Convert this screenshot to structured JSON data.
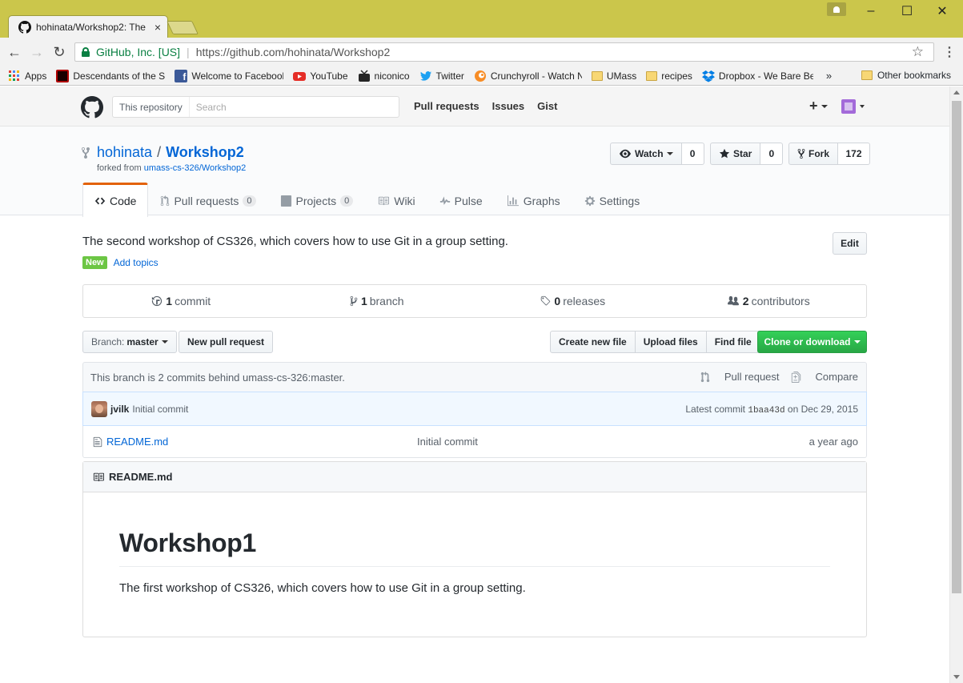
{
  "browser": {
    "tab_title": "hohinata/Workshop2: The",
    "tab_close": "×",
    "secure_label": "GitHub, Inc. [US]",
    "url": "https://github.com/hohinata/Workshop2",
    "window_controls": {
      "minimize": "–",
      "maximize": "☐",
      "close": "✕"
    },
    "nav": {
      "back": "←",
      "forward": "→",
      "reload": "↻"
    },
    "star": "☆",
    "menu": "⋮",
    "bookmarks": [
      {
        "label": "Apps",
        "icon": "apps-grid-icon",
        "color": "#e34133"
      },
      {
        "label": "Descendants of the Su",
        "icon": "descendants-favicon",
        "color": "#b00000"
      },
      {
        "label": "Welcome to Facebook",
        "icon": "facebook-favicon",
        "color": "#3b5998"
      },
      {
        "label": "YouTube",
        "icon": "youtube-favicon",
        "color": "#e52d27"
      },
      {
        "label": "niconico",
        "icon": "niconico-favicon",
        "color": "#252525"
      },
      {
        "label": "Twitter",
        "icon": "twitter-favicon",
        "color": "#1da1f2"
      },
      {
        "label": "Crunchyroll - Watch N",
        "icon": "crunchyroll-favicon",
        "color": "#f78c25"
      },
      {
        "label": "UMass",
        "icon": "folder-icon",
        "color": "#f8d775"
      },
      {
        "label": "recipes",
        "icon": "folder-icon",
        "color": "#f8d775"
      },
      {
        "label": "Dropbox - We Bare Be",
        "icon": "dropbox-favicon",
        "color": "#007ee5"
      }
    ],
    "bookmarks_more": "»",
    "other_bookmarks": "Other bookmarks"
  },
  "github": {
    "search_scope": "This repository",
    "search_placeholder": "Search",
    "nav": [
      "Pull requests",
      "Issues",
      "Gist"
    ],
    "plus": "+",
    "repo": {
      "owner": "hohinata",
      "separator": "/",
      "name": "Workshop2",
      "forked_prefix": "forked from",
      "forked_from": "umass-cs-326/Workshop2"
    },
    "actions": {
      "watch_label": "Watch",
      "watch_count": "0",
      "star_label": "Star",
      "star_count": "0",
      "fork_label": "Fork",
      "fork_count": "172"
    },
    "tabs": [
      {
        "label": "Code",
        "icon": "code-icon"
      },
      {
        "label": "Pull requests",
        "counter": "0",
        "icon": "pull-request-icon"
      },
      {
        "label": "Projects",
        "counter": "0",
        "icon": "project-icon"
      },
      {
        "label": "Wiki",
        "icon": "book-icon"
      },
      {
        "label": "Pulse",
        "icon": "pulse-icon"
      },
      {
        "label": "Graphs",
        "icon": "graph-icon"
      },
      {
        "label": "Settings",
        "icon": "gear-icon"
      }
    ],
    "description": "The second workshop of CS326, which covers how to use Git in a group setting.",
    "edit_label": "Edit",
    "new_badge": "New",
    "add_topics": "Add topics",
    "numbers": [
      {
        "count": "1",
        "label": "commit",
        "icon": "history-icon"
      },
      {
        "count": "1",
        "label": "branch",
        "icon": "branch-icon"
      },
      {
        "count": "0",
        "label": "releases",
        "icon": "tag-icon"
      },
      {
        "count": "2",
        "label": "contributors",
        "icon": "people-icon"
      }
    ],
    "branch_select_label": "Branch:",
    "branch_select_value": "master",
    "new_pull_request": "New pull request",
    "create_new_file": "Create new file",
    "upload_files": "Upload files",
    "find_file": "Find file",
    "clone_or_download": "Clone or download",
    "branch_infobar": "This branch is 2 commits behind umass-cs-326:master.",
    "pull_request_link": "Pull request",
    "compare_link": "Compare",
    "commit": {
      "author": "jvilk",
      "message": "Initial commit",
      "latest_prefix": "Latest commit",
      "sha": "1baa43d",
      "date_text": "on Dec 29, 2015"
    },
    "files": [
      {
        "name": "README.md",
        "message": "Initial commit",
        "age": "a year ago"
      }
    ],
    "readme": {
      "header": "README.md",
      "h1": "Workshop1",
      "paragraph": "The first workshop of CS326, which covers how to use Git in a group setting."
    }
  }
}
